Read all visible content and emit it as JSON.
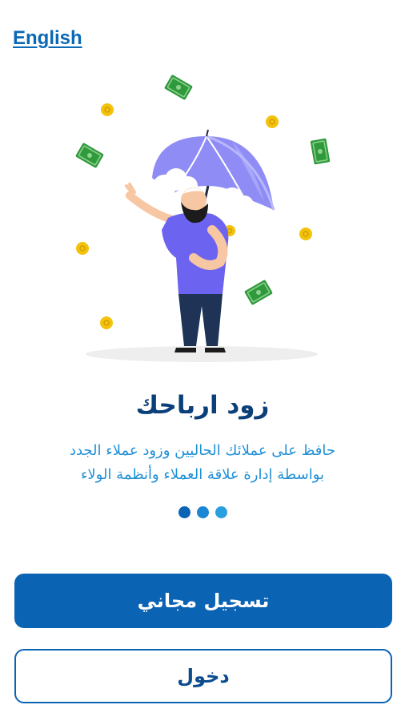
{
  "header": {
    "language_link": "English"
  },
  "onboarding": {
    "title": "زود ارباحك",
    "description_lines": [
      "حافظ على عملائك الحاليين وزود عملاء الجدد",
      "بواسطة إدارة علاقة العملاء وأنظمة الولاء"
    ],
    "illustration": "man-with-umbrella-money-rain",
    "pagination": {
      "count": 3,
      "active_index": 0,
      "colors": [
        "#0b63b4",
        "#1a86d4",
        "#2a9fe0"
      ]
    }
  },
  "actions": {
    "register_label": "تسجيل مجاني",
    "login_label": "دخول"
  },
  "colors": {
    "primary": "#0b63b4",
    "title": "#0a3f7a",
    "subtitle": "#1f8fd6",
    "umbrella": "#8f8df5",
    "shirt": "#6c63f0",
    "money": "#2f9a3c",
    "coin": "#f4c20d"
  }
}
